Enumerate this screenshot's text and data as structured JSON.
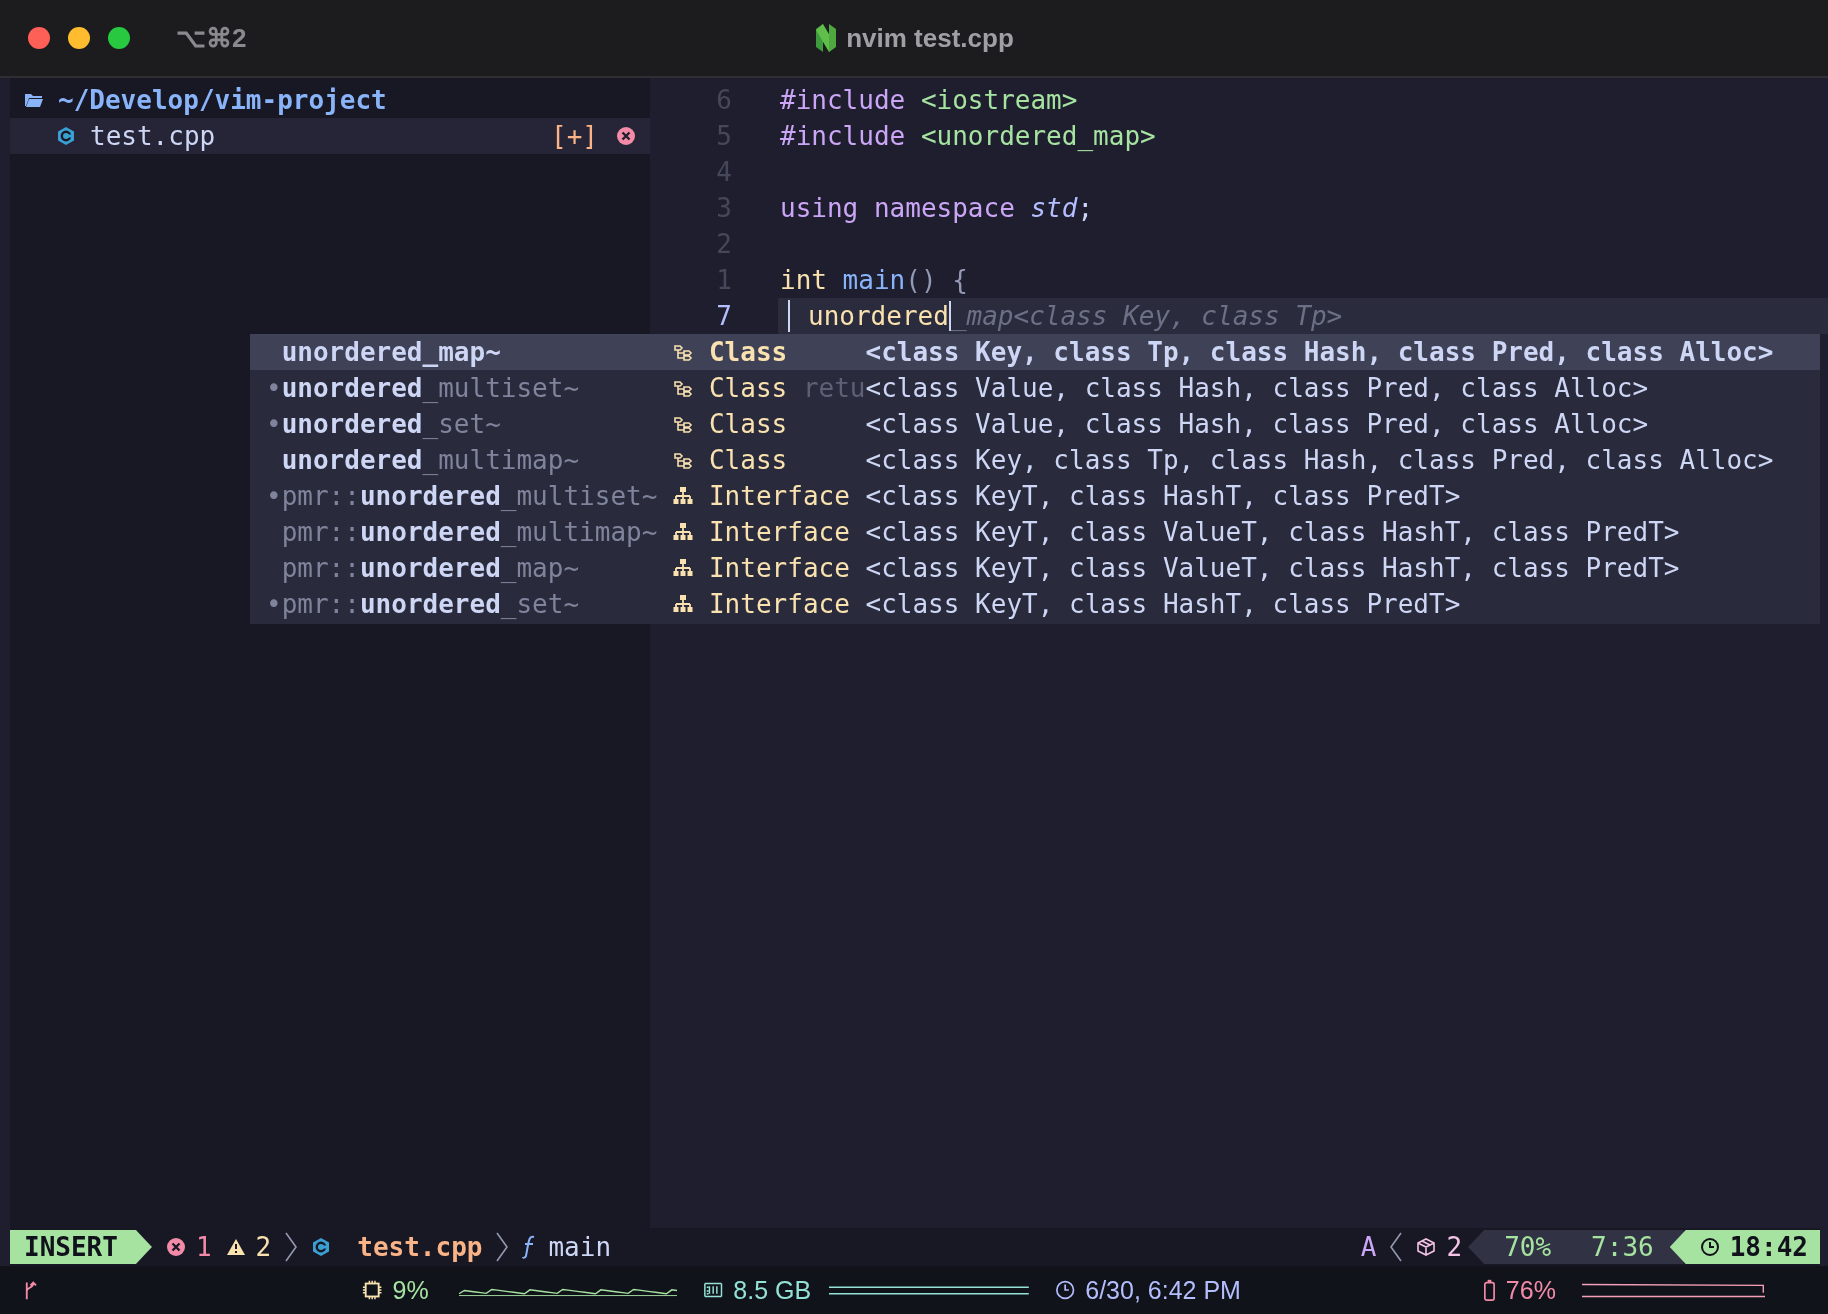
{
  "window": {
    "title": "nvim test.cpp",
    "shortcut": "⌥⌘2"
  },
  "sidebar": {
    "root": "~/Develop/vim-project",
    "files": [
      {
        "name": "test.cpp",
        "modified": "[+]",
        "selected": true
      }
    ]
  },
  "editor": {
    "lines": [
      {
        "number": "6",
        "current": false,
        "tokens": [
          {
            "kind": "keyword",
            "text": "#include"
          },
          {
            "kind": "string",
            "text": " <iostream>"
          }
        ]
      },
      {
        "number": "5",
        "current": false,
        "tokens": [
          {
            "kind": "keyword",
            "text": "#include"
          },
          {
            "kind": "string",
            "text": " <unordered_map>"
          }
        ]
      },
      {
        "number": "4",
        "current": false
      },
      {
        "number": "3",
        "current": false,
        "tokens": [
          {
            "kind": "keyword",
            "text": "using namespace"
          },
          {
            "kind": "namespace",
            "text": " std"
          },
          {
            "kind": "plain",
            "text": ";"
          }
        ]
      },
      {
        "number": "2",
        "current": false
      },
      {
        "number": "1",
        "current": false,
        "tokens": [
          {
            "kind": "type",
            "text": "int"
          },
          {
            "kind": "function",
            "text": " main"
          },
          {
            "kind": "punct",
            "text": "() {"
          }
        ]
      },
      {
        "number": "7",
        "current": true,
        "tokens": [
          {
            "kind": "typed",
            "text": "unordered"
          }
        ],
        "ghost": "_map<class Key, class Tp>"
      }
    ]
  },
  "completion": {
    "items": [
      {
        "match": "unordered",
        "rest": "_map~",
        "kind": "class",
        "kind_label": "Class",
        "detail": "<class Key, class Tp, class Hash, class Pred, class Alloc>",
        "selected": true
      },
      {
        "bullet": "•",
        "match": "unordered",
        "rest": "_multiset~",
        "kind": "class",
        "kind_label": "Class",
        "behind": "retu",
        "detail": "<class Value, class Hash, class Pred, class Alloc>",
        "selected": false
      },
      {
        "bullet": "•",
        "match": "unordered",
        "rest": "_set~",
        "kind": "class",
        "kind_label": "Class",
        "detail": "<class Value, class Hash, class Pred, class Alloc>",
        "selected": false
      },
      {
        "match": "unordered",
        "rest": "_multimap~",
        "kind": "class",
        "kind_label": "Class",
        "detail": "<class Key, class Tp, class Hash, class Pred, class Alloc>",
        "selected": false
      },
      {
        "bullet": "•",
        "prefix": "pmr::",
        "match": "unordered",
        "rest": "_multiset~",
        "kind": "interface",
        "kind_label": "Interface",
        "detail": "<class KeyT, class HashT, class PredT>",
        "selected": false
      },
      {
        "prefix": "pmr::",
        "match": "unordered",
        "rest": "_multimap~",
        "kind": "interface",
        "kind_label": "Interface",
        "detail": "<class KeyT, class ValueT, class HashT, class PredT>",
        "selected": false
      },
      {
        "prefix": "pmr::",
        "match": "unordered",
        "rest": "_map~",
        "kind": "interface",
        "kind_label": "Interface",
        "detail": "<class KeyT, class ValueT, class HashT, class PredT>",
        "selected": false
      },
      {
        "bullet": "•",
        "prefix": "pmr::",
        "match": "unordered",
        "rest": "_set~",
        "kind": "interface",
        "kind_label": "Interface",
        "detail": "<class KeyT, class HashT, class PredT>",
        "selected": false
      }
    ]
  },
  "statusline": {
    "mode": "INSERT",
    "errors": "1",
    "warnings": "2",
    "file": "test.cpp",
    "symbol": "main",
    "format": "A",
    "packages": "2",
    "percent": "70%",
    "position": "7:36",
    "time": "18:42"
  },
  "bottom_bar": {
    "cpu": "9%",
    "memory": "8.5 GB",
    "datetime": "6/30, 6:42 PM",
    "battery": "76%"
  }
}
